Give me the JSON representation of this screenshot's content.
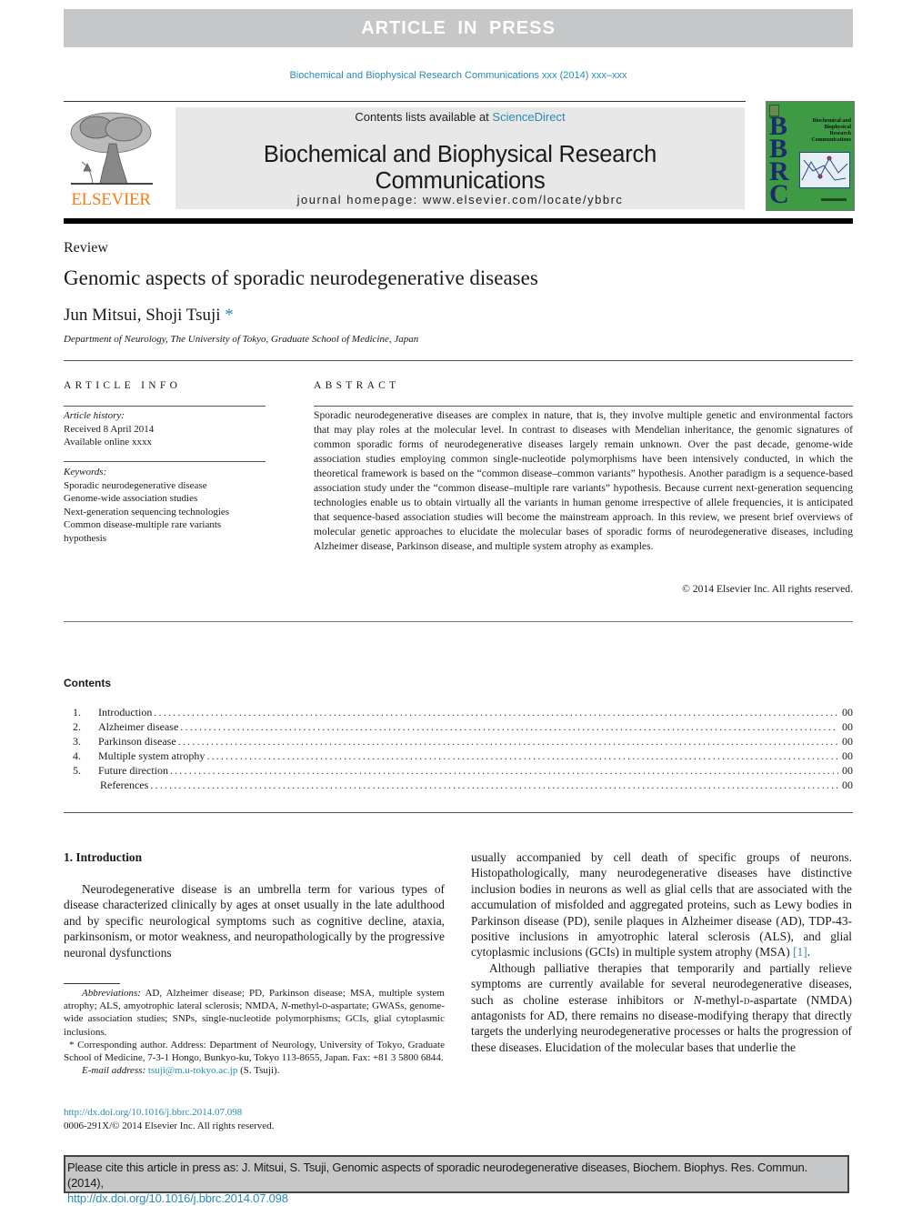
{
  "banner": {
    "label": "ARTICLE IN PRESS"
  },
  "journal_citation": "Biochemical and Biophysical Research Communications xxx (2014) xxx–xxx",
  "header": {
    "publisher_wordmark": "ELSEVIER",
    "contents_prefix": "Contents lists available at ",
    "contents_link": "ScienceDirect",
    "journal_name": "Biochemical and Biophysical Research Communications",
    "homepage": "journal homepage: www.elsevier.com/locate/ybbrc",
    "cover": {
      "letters": [
        "B",
        "B",
        "R",
        "C"
      ],
      "title_lines": [
        "Biochemical and",
        "Biophysical",
        "Research",
        "Communications"
      ],
      "colors": {
        "background": "#3f9a45",
        "letters": "#1d2a6b"
      }
    }
  },
  "article": {
    "type": "Review",
    "title": "Genomic aspects of sporadic neurodegenerative diseases",
    "authors": "Jun Mitsui, Shoji Tsuji",
    "author_marker": "*",
    "affiliation": "Department of Neurology, The University of Tokyo, Graduate School of Medicine, Japan"
  },
  "article_info": {
    "heading": "ARTICLE INFO",
    "history_label": "Article history:",
    "history": [
      "Received 8 April 2014",
      "Available online xxxx"
    ],
    "keywords_label": "Keywords:",
    "keywords": [
      "Sporadic neurodegenerative disease",
      "Genome-wide association studies",
      "Next-generation sequencing technologies",
      "Common disease-multiple rare variants hypothesis"
    ]
  },
  "abstract": {
    "heading": "ABSTRACT",
    "text": "Sporadic neurodegenerative diseases are complex in nature, that is, they involve multiple genetic and environmental factors that may play roles at the molecular level. In contrast to diseases with Mendelian inheritance, the genomic signatures of common sporadic forms of neurodegenerative diseases largely remain unknown. Over the past decade, genome-wide association studies employing common single-nucleotide polymorphisms have been intensively conducted, in which the theoretical framework is based on the “common disease–common variants” hypothesis. Another paradigm is a sequence-based association study under the “common disease–multiple rare variants” hypothesis. Because current next-generation sequencing technologies enable us to obtain virtually all the variants in human genome irrespective of allele frequencies, it is anticipated that sequence-based association studies will become the mainstream approach. In this review, we present brief overviews of molecular genetic approaches to elucidate the molecular bases of sporadic forms of neurodegenerative diseases, including Alzheimer disease, Parkinson disease, and multiple system atrophy as examples.",
    "copyright": "© 2014 Elsevier Inc. All rights reserved."
  },
  "contents": {
    "heading": "Contents",
    "items": [
      {
        "num": "1.",
        "title": "Introduction",
        "page": "00"
      },
      {
        "num": "2.",
        "title": "Alzheimer disease",
        "page": "00"
      },
      {
        "num": "3.",
        "title": "Parkinson disease",
        "page": "00"
      },
      {
        "num": "4.",
        "title": "Multiple system atrophy",
        "page": "00"
      },
      {
        "num": "5.",
        "title": "Future direction",
        "page": "00"
      },
      {
        "num": "",
        "title": "References",
        "page": "00"
      }
    ]
  },
  "body": {
    "intro_heading": "1. Introduction",
    "left_paragraph": "Neurodegenerative disease is an umbrella term for various types of disease characterized clinically by ages at onset usually in the late adulthood and by specific neurological symptoms such as cognitive decline, ataxia, parkinsonism, or motor weakness, and neuropathologically by the progressive neuronal dysfunctions",
    "right_paragraph_1": "usually accompanied by cell death of specific groups of neurons. Histopathologically, many neurodegenerative diseases have distinctive inclusion bodies in neurons as well as glial cells that are associated with the accumulation of misfolded and aggregated proteins, such as Lewy bodies in Parkinson disease (PD), senile plaques in Alzheimer disease (AD), TDP-43-positive inclusions in amyotrophic lateral sclerosis (ALS), and glial cytoplasmic inclusions (GCIs) in multiple system atrophy (MSA) ",
    "right_paragraph_1_ref": "[1]",
    "right_paragraph_1_end": ".",
    "right_paragraph_2_a": "Although palliative therapies that temporarily and partially relieve symptoms are currently available for several neurodegenerative diseases, such as choline esterase inhibitors or ",
    "right_paragraph_2_italic": "N",
    "right_paragraph_2_b": "-methyl-",
    "right_paragraph_2_smallcap": "d",
    "right_paragraph_2_c": "-aspartate (NMDA) antagonists for AD, there remains no disease-modifying therapy that directly targets the underlying neurodegenerative processes or halts the progression of these diseases. Elucidation of the molecular bases that underlie the"
  },
  "footnotes": {
    "abbrev_label": "Abbreviations:",
    "abbrev_a": " AD, Alzheimer disease; PD, Parkinson disease; MSA, multiple system atrophy; ALS, amyotrophic lateral sclerosis; NMDA, ",
    "abbrev_italic": "N",
    "abbrev_b": "-methyl-",
    "abbrev_smallcap": "d",
    "abbrev_c": "-aspartate; GWASs, genome-wide association studies; SNPs, single-nucleotide polymorphisms; GCIs, glial cytoplasmic inclusions.",
    "corresponding_marker": "*",
    "corresponding": " Corresponding author. Address: Department of Neurology, University of Tokyo, Graduate School of Medicine, 7-3-1 Hongo, Bunkyo-ku, Tokyo 113-8655, Japan. Fax: +81 3 5800 6844.",
    "email_label": "E-mail address:",
    "email": "tsuji@m.u-tokyo.ac.jp",
    "email_suffix": " (S. Tsuji)."
  },
  "doi": {
    "link": "http://dx.doi.org/10.1016/j.bbrc.2014.07.098",
    "issn_line": "0006-291X/© 2014 Elsevier Inc. All rights reserved."
  },
  "cite_box": {
    "text": "Please cite this article in press as: J. Mitsui, S. Tsuji, Genomic aspects of sporadic neurodegenerative diseases, Biochem. Biophys. Res. Commun. (2014),",
    "link": "http://dx.doi.org/10.1016/j.bbrc.2014.07.098"
  }
}
